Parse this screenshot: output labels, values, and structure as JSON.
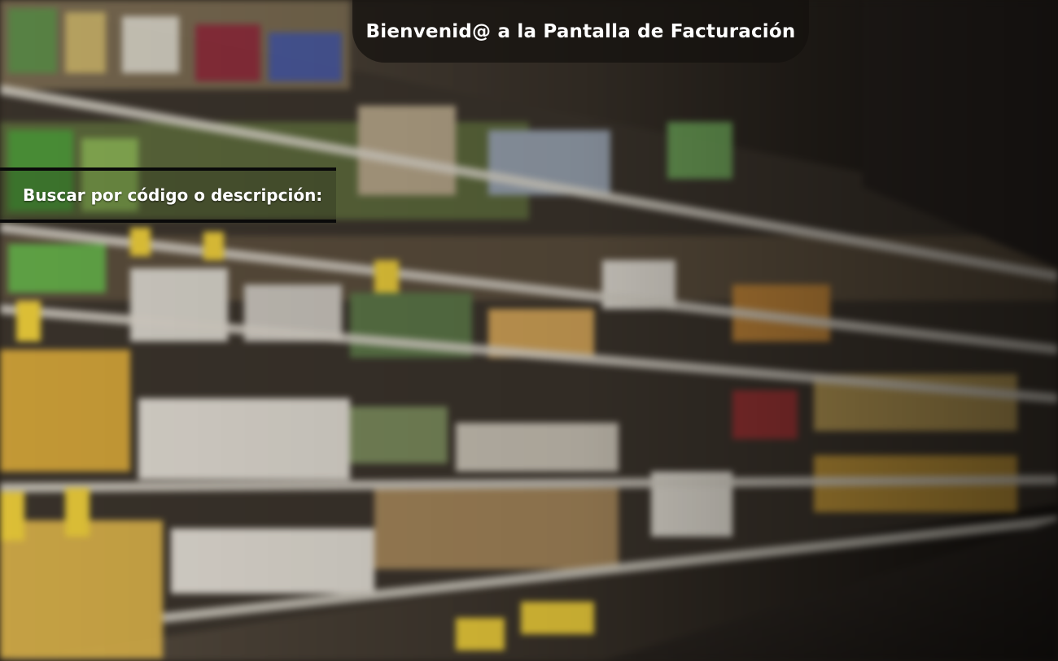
{
  "header": {
    "title": "Bienvenid@ a la Pantalla de Facturación"
  },
  "search": {
    "label": "Buscar por código o descripción:"
  },
  "background": {
    "description_icon": "supermarket-shelves-background",
    "tint": "#2a241e"
  }
}
